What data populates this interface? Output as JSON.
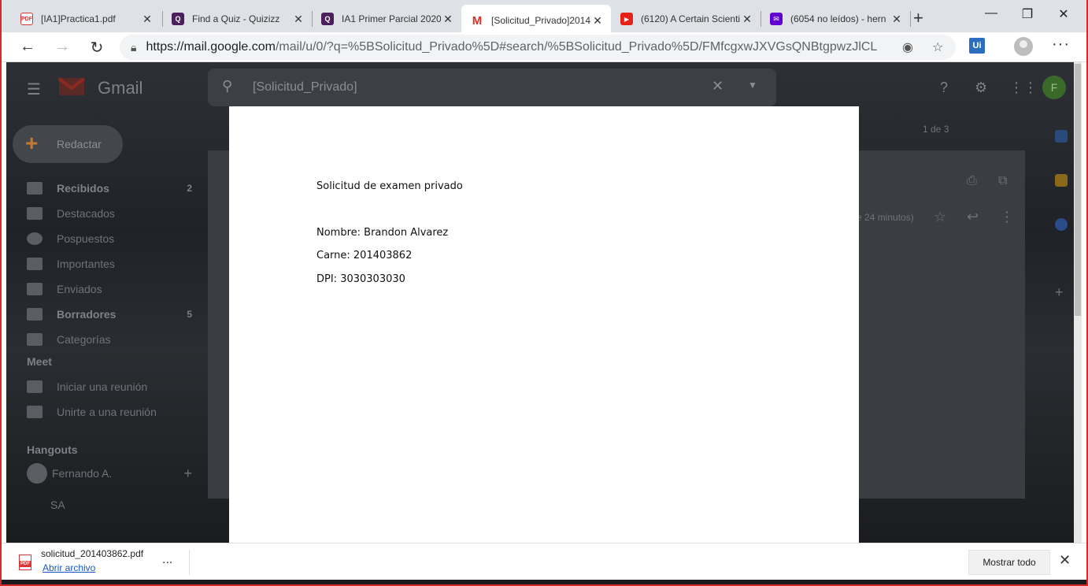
{
  "browser": {
    "tabs": [
      {
        "label": "[IA1]Practica1.pdf",
        "icon": "pdf-icon",
        "active": false
      },
      {
        "label": "Find a Quiz - Quizizz",
        "icon": "quizizz-icon",
        "active": false
      },
      {
        "label": "IA1 Primer Parcial 2020",
        "icon": "quizizz-icon",
        "active": false
      },
      {
        "label": "[Solicitud_Privado]2014",
        "icon": "gmail-icon",
        "active": true
      },
      {
        "label": "(6120) A Certain Scienti",
        "icon": "youtube-icon",
        "active": false
      },
      {
        "label": "(6054 no leídos) - hern",
        "icon": "mail-icon",
        "active": false
      }
    ],
    "url_host": "https://mail.google.com",
    "url_path": "/mail/u/0/?q=%5BSolicitud_Privado%5D#search/%5BSolicitud_Privado%5D/FMfcgxwJXVGsQNBtgpwzJlCLr...",
    "extension_label": "Ui"
  },
  "gmail": {
    "brand": "Gmail",
    "search_value": "[Solicitud_Privado]",
    "compose_label": "Redactar",
    "pager": "1 de 3",
    "time_ago": "e 24 minutos)",
    "nav": [
      {
        "label": "Recibidos",
        "count": "2",
        "bold": true
      },
      {
        "label": "Destacados",
        "count": "",
        "bold": false
      },
      {
        "label": "Pospuestos",
        "count": "",
        "bold": false
      },
      {
        "label": "Importantes",
        "count": "",
        "bold": false
      },
      {
        "label": "Enviados",
        "count": "",
        "bold": false
      },
      {
        "label": "Borradores",
        "count": "5",
        "bold": true
      },
      {
        "label": "Categorías",
        "count": "",
        "bold": false
      }
    ],
    "meet_header": "Meet",
    "meet_items": [
      "Iniciar una reunión",
      "Unirte a una reunión"
    ],
    "hangouts_header": "Hangouts",
    "hangouts_user": "Fernando A.",
    "hangouts_contact": "SA",
    "avatar_letter": "F"
  },
  "document": {
    "title": "Solicitud de examen privado",
    "name_line": "Nombre: Brandon Alvarez",
    "carne_line": "Carne: 201403862",
    "dpi_line": "DPI: 3030303030"
  },
  "download": {
    "filename": "solicitud_201403862.pdf",
    "open_label": "Abrir archivo",
    "more_label": "...",
    "show_all_label": "Mostrar todo"
  },
  "colors": {
    "frame": "#d42a2a",
    "gmail_red": "#d93025",
    "link": "#1a57c4"
  }
}
